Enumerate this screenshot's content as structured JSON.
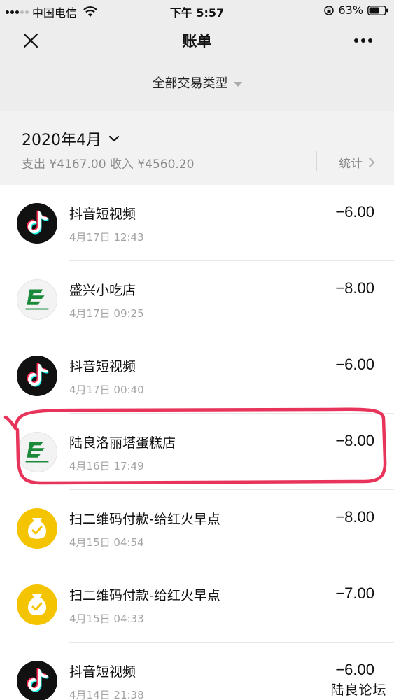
{
  "status_bar": {
    "carrier": "中国电信",
    "time": "下午 5:57",
    "battery": "63%"
  },
  "nav": {
    "title": "账单"
  },
  "filter": {
    "label": "全部交易类型"
  },
  "month": {
    "title": "2020年4月",
    "summary": "支出 ¥4167.00 收入 ¥4560.20",
    "stats_label": "统计"
  },
  "transactions": [
    {
      "merchant": "抖音短视频",
      "datetime": "4月17日 12:43",
      "amount": "−6.00",
      "icon": "tiktok-icon"
    },
    {
      "merchant": "盛兴小吃店",
      "datetime": "4月17日 09:25",
      "amount": "−8.00",
      "icon": "post-bank-icon"
    },
    {
      "merchant": "抖音短视频",
      "datetime": "4月17日 00:40",
      "amount": "−6.00",
      "icon": "tiktok-icon"
    },
    {
      "merchant": "陆良洛丽塔蛋糕店",
      "datetime": "4月16日 17:49",
      "amount": "−8.00",
      "icon": "post-bank-icon"
    },
    {
      "merchant": "扫二维码付款-给红火早点",
      "datetime": "4月15日 04:54",
      "amount": "−8.00",
      "icon": "qr-pay-icon"
    },
    {
      "merchant": "扫二维码付款-给红火早点",
      "datetime": "4月15日 04:33",
      "amount": "−7.00",
      "icon": "qr-pay-icon"
    },
    {
      "merchant": "抖音短视频",
      "datetime": "4月14日 21:38",
      "amount": "−6.00",
      "icon": "tiktok-icon"
    }
  ],
  "watermark": "陆良论坛",
  "colors": {
    "highlight_stroke": "#e8335a",
    "qr_pay_yellow": "#f5c400",
    "post_bank_green": "#1a8a3a"
  }
}
